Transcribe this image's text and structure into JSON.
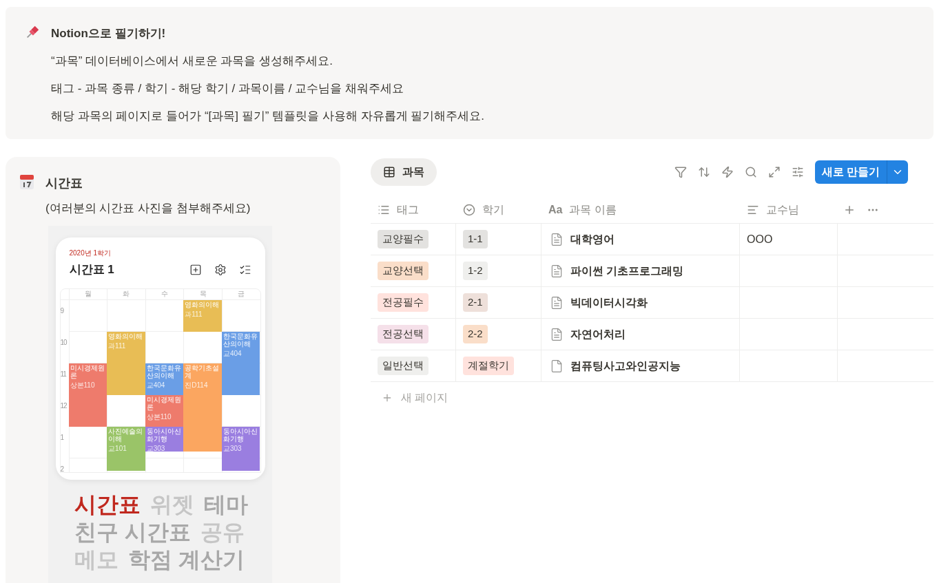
{
  "callout": {
    "title": "Notion으로 필기하기!",
    "lines": [
      "“과목” 데이터베이스에서 새로운 과목을 생성해주세요.",
      "태그 - 과목 종류 / 학기 - 해당 학기 / 과목이름 / 교수님을 채워주세요",
      "해당 과목의 페이지로 들어가 “[과목] 필기” 템플릿을 사용해 자유롭게 필기해주세요."
    ]
  },
  "timetable_block": {
    "title": "시간표",
    "caption": "(여러분의 시간표 사진을 첨부해주세요)",
    "image": {
      "semester": "2020년 1학기",
      "title": "시간표 1",
      "days": [
        "월",
        "화",
        "수",
        "목",
        "금"
      ],
      "hours": [
        "9",
        "10",
        "11",
        "12",
        "1",
        "2"
      ],
      "classes": [
        {
          "name": "영화의이해",
          "room": "과111",
          "color": "#e8bd55"
        },
        {
          "name": "영화의이해",
          "room": "과111",
          "color": "#e8bd55"
        },
        {
          "name": "한국문화유산의이해",
          "room": "교404",
          "color": "#6a9ee6"
        },
        {
          "name": "미시경제원론",
          "room": "상본110",
          "color": "#ee7b6c"
        },
        {
          "name": "한국문화유산의이해",
          "room": "교404",
          "color": "#6a9ee6"
        },
        {
          "name": "공학기초설계",
          "room": "진D114",
          "color": "#fba660"
        },
        {
          "name": "미시경제원론",
          "room": "상본110",
          "color": "#ee7b6c"
        },
        {
          "name": "사진예술의이해",
          "room": "교101",
          "color": "#9ac468"
        },
        {
          "name": "동아시아신화기행",
          "room": "교303",
          "color": "#9a7ee0"
        },
        {
          "name": "동아시아신화기행",
          "room": "교303",
          "color": "#9a7ee0"
        }
      ],
      "features": [
        [
          {
            "label": "시간표",
            "kind": "active"
          },
          {
            "label": "위젯",
            "kind": "faint"
          },
          {
            "label": "테마",
            "kind": "dim"
          }
        ],
        [
          {
            "label": "친구 시간표",
            "kind": "dim"
          },
          {
            "label": "공유",
            "kind": "faint"
          }
        ],
        [
          {
            "label": "메모",
            "kind": "faint"
          },
          {
            "label": "학점 계산기",
            "kind": "dim"
          }
        ]
      ]
    }
  },
  "database": {
    "views": [
      {
        "label": "과목",
        "selected": true
      }
    ],
    "new_button": "새로 만들기",
    "columns": [
      {
        "label": "태그",
        "kind": "multi"
      },
      {
        "label": "학기",
        "kind": "status"
      },
      {
        "label": "과목 이름",
        "kind": "title",
        "type_icon": "Aa"
      },
      {
        "label": "교수님",
        "kind": "text"
      }
    ],
    "rows": [
      {
        "tag": {
          "label": "교양필수",
          "color": "#e3e2e0"
        },
        "semester": {
          "label": "1-1",
          "color": "#e3e2e0"
        },
        "name": "대학영어",
        "has_content": true,
        "professor": "OOO"
      },
      {
        "tag": {
          "label": "교양선택",
          "color": "#fadec9"
        },
        "semester": {
          "label": "1-2",
          "color": "#efefed"
        },
        "name": "파이썬 기초프로그래밍",
        "has_content": true
      },
      {
        "tag": {
          "label": "전공필수",
          "color": "#ffe2dd"
        },
        "semester": {
          "label": "2-1",
          "color": "#eee0da"
        },
        "name": "빅데이터시각화",
        "has_content": true
      },
      {
        "tag": {
          "label": "전공선택",
          "color": "#f5e0e9"
        },
        "semester": {
          "label": "2-2",
          "color": "#fadec9"
        },
        "name": "자연어처리",
        "has_content": true
      },
      {
        "tag": {
          "label": "일반선택",
          "color": "#efefed"
        },
        "semester": {
          "label": "계절학기",
          "color": "#ffe2dd"
        },
        "name": "컴퓨팅사고와인공지능",
        "has_content": false
      }
    ],
    "add_row": "새 페이지"
  }
}
